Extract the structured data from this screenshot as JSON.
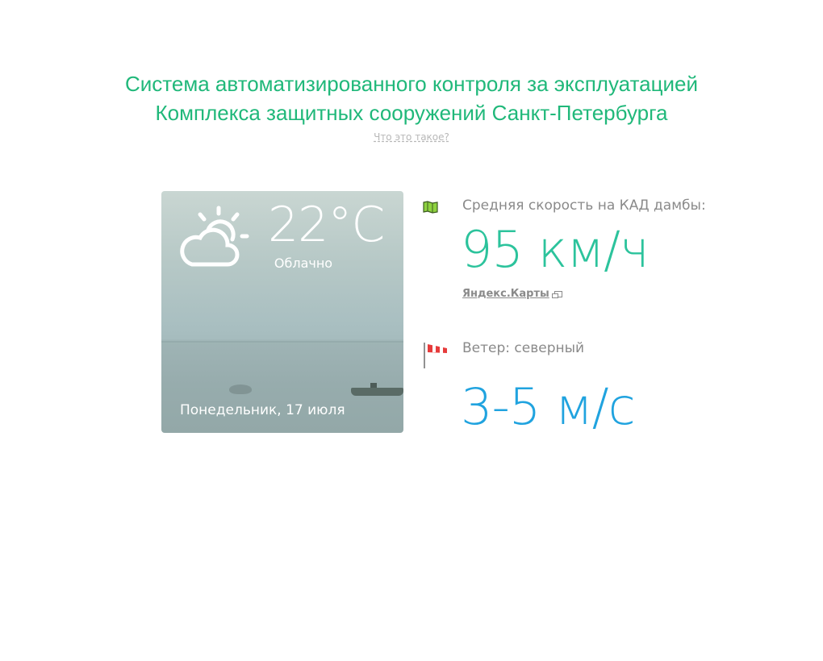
{
  "header": {
    "title_line1": "Система автоматизированного контроля за эксплуатацией",
    "title_line2": "Комплекса защитных сооружений Санкт-Петербурга",
    "what_is_link": "Что это такое?"
  },
  "weather": {
    "icon": "partly-cloudy-icon",
    "temperature": "22°С",
    "condition": "Облачно",
    "date": "Понедельник, 17 июля"
  },
  "traffic": {
    "icon": "map-icon",
    "label": "Средняя скорость на КАД дамбы:",
    "value": "95 км/ч",
    "source_link": "Яндекс.Карты",
    "source_link_icon": "external-link-icon"
  },
  "wind": {
    "icon": "windsock-icon",
    "label": "Ветер: северный",
    "value": "3-5 м/с"
  },
  "colors": {
    "title": "#20b87a",
    "speed_value": "#2cc39c",
    "wind_value": "#20a3df",
    "label": "#8a8a8a"
  }
}
